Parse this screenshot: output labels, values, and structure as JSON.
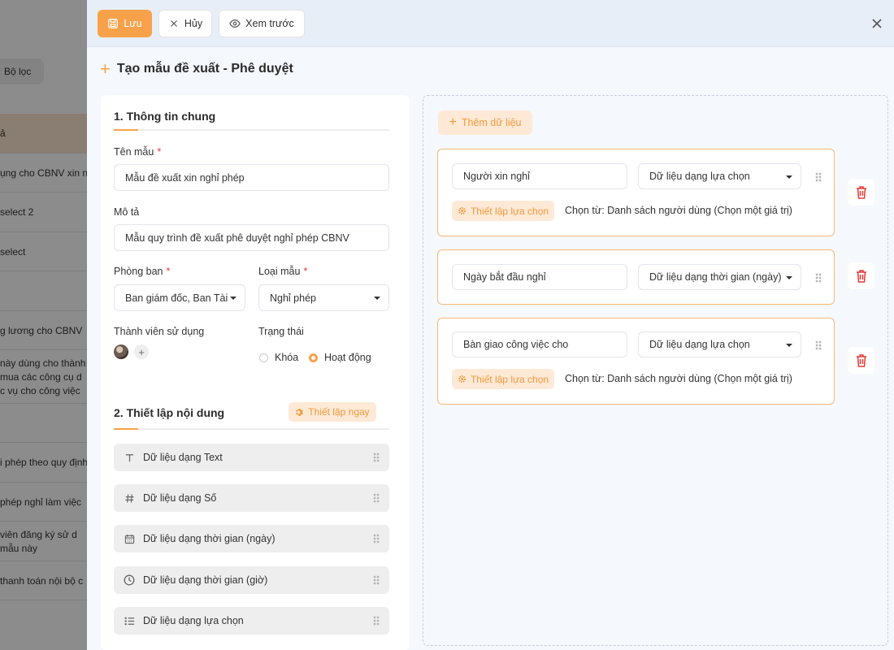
{
  "background": {
    "filter_label": "Bộ lọc",
    "rows": [
      {
        "text": "ả"
      },
      {
        "text": "ụng cho CBNV xin n"
      },
      {
        "text": "select 2"
      },
      {
        "text": "select"
      },
      {
        "text": ""
      },
      {
        "text": "g lương cho CBNV"
      },
      {
        "text": "này dùng cho thành\nmua các công cụ d\nc vụ cho công việc"
      },
      {
        "text": ""
      },
      {
        "text": "i phép theo quy định"
      },
      {
        "text": "phép nghỉ làm việc"
      },
      {
        "text": "viên đăng ký sử d\nmẫu này"
      },
      {
        "text": "thanh toán nội bộ c"
      }
    ]
  },
  "toolbar": {
    "save_label": "Lưu",
    "cancel_label": "Hủy",
    "preview_label": "Xem trước"
  },
  "page_title": "Tạo mẫu đề xuất - Phê duyệt",
  "general": {
    "section_title": "1. Thông tin chung",
    "template_name_label": "Tên mẫu",
    "template_name_value": "Mẫu đề xuất xin nghỉ phép",
    "description_label": "Mô tả",
    "description_value": "Mẫu quy trình đề xuất phê duyệt nghỉ phép CBNV",
    "department_label": "Phòng ban",
    "department_value": "Ban giám đốc, Ban Tài",
    "template_type_label": "Loại mẫu",
    "template_type_value": "Nghỉ phép",
    "members_label": "Thành viên sử dụng",
    "status_label": "Trạng thái",
    "status_options": [
      "Khóa",
      "Hoạt động"
    ],
    "status_selected": "Hoạt động"
  },
  "content": {
    "section_title": "2. Thiết lập nội dung",
    "setup_now_label": "Thiết lập ngay",
    "data_types": [
      {
        "label": "Dữ liệu dạng Text",
        "icon": "text-icon"
      },
      {
        "label": "Dữ liệu dạng Số",
        "icon": "hash-icon"
      },
      {
        "label": "Dữ liệu dạng thời gian (ngày)",
        "icon": "calendar-icon"
      },
      {
        "label": "Dữ liệu dạng thời gian (giờ)",
        "icon": "clock-icon"
      },
      {
        "label": "Dữ liệu dạng lựa chọn",
        "icon": "list-icon"
      }
    ]
  },
  "builder": {
    "add_data_label": "Thêm dữ liệu",
    "fields": [
      {
        "name": "Người xin nghỉ",
        "type": "Dữ liệu dạng lựa chọn",
        "setup_label": "Thiết lập lựa chọn",
        "source": "Chọn từ: Danh sách người dùng (Chọn một giá trị)"
      },
      {
        "name": "Ngày bắt đầu nghỉ",
        "type": "Dữ liệu dạng thời gian (ngày)"
      },
      {
        "name": "Bàn giao công việc cho",
        "type": "Dữ liệu dạng lựa chọn",
        "setup_label": "Thiết lập lựa chọn",
        "source": "Chọn từ: Danh sách người dùng (Chọn một giá trị)"
      }
    ]
  },
  "colors": {
    "accent": "#f7a24b",
    "accent_soft": "#fde9d6",
    "danger": "#e53935"
  }
}
